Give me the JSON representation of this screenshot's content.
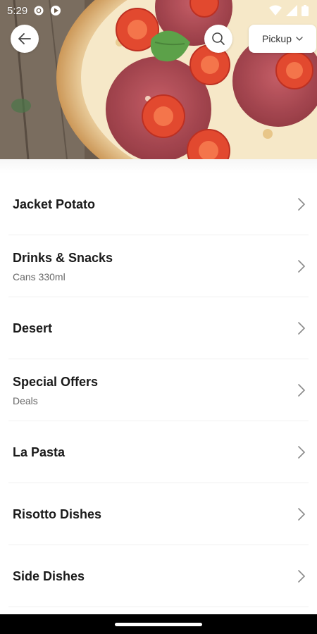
{
  "status_bar": {
    "time": "5:29",
    "left_icons": [
      "settings-icon",
      "play-icon"
    ],
    "right_icons": [
      "wifi-icon",
      "signal-icon",
      "battery-icon"
    ]
  },
  "header": {
    "image": "pizza-header-image",
    "back_icon": "arrow-left-icon",
    "search_icon": "search-icon",
    "order_mode": "Pickup",
    "order_mode_icon": "chevron-down-icon"
  },
  "categories": [
    {
      "title": "Jacket Potato",
      "subtitle": ""
    },
    {
      "title": "Drinks & Snacks",
      "subtitle": "Cans 330ml"
    },
    {
      "title": "Desert",
      "subtitle": ""
    },
    {
      "title": "Special Offers",
      "subtitle": "Deals"
    },
    {
      "title": "La Pasta",
      "subtitle": ""
    },
    {
      "title": "Risotto Dishes",
      "subtitle": ""
    },
    {
      "title": "Side Dishes",
      "subtitle": ""
    }
  ],
  "colors": {
    "text_primary": "#1a1a1a",
    "text_secondary": "#666666",
    "chevron": "#8a8a8a",
    "nav_bar": "#000000"
  }
}
